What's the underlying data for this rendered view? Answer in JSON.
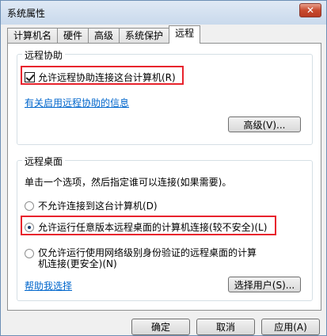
{
  "window": {
    "title": "系统属性",
    "close_label": "✕"
  },
  "tabs": [
    {
      "label": "计算机名"
    },
    {
      "label": "硬件"
    },
    {
      "label": "高级"
    },
    {
      "label": "系统保护"
    },
    {
      "label": "远程"
    }
  ],
  "remote_assistance": {
    "group_title": "远程协助",
    "checkbox_label": "允许远程协助连接这台计算机(R)",
    "checkbox_checked": true,
    "info_link": "有关启用远程协助的信息",
    "advanced_button": "高级(V)..."
  },
  "remote_desktop": {
    "group_title": "远程桌面",
    "instruction": "单击一个选项，然后指定谁可以连接(如果需要)。",
    "options": [
      {
        "label": "不允许连接到这台计算机(D)",
        "selected": false
      },
      {
        "label": "允许运行任意版本远程桌面的计算机连接(较不安全)(L)",
        "selected": true
      },
      {
        "label_line1": "仅允许运行使用网络级别身份验证的远程桌面的计算",
        "label_line2": "机连接(更安全)(N)",
        "selected": false
      }
    ],
    "help_link": "帮助我选择",
    "select_users_button": "选择用户(S)..."
  },
  "footer": {
    "ok": "确定",
    "cancel": "取消",
    "apply": "应用(A)"
  },
  "colors": {
    "highlight_box": "#e8232d",
    "link": "#0066cc"
  }
}
